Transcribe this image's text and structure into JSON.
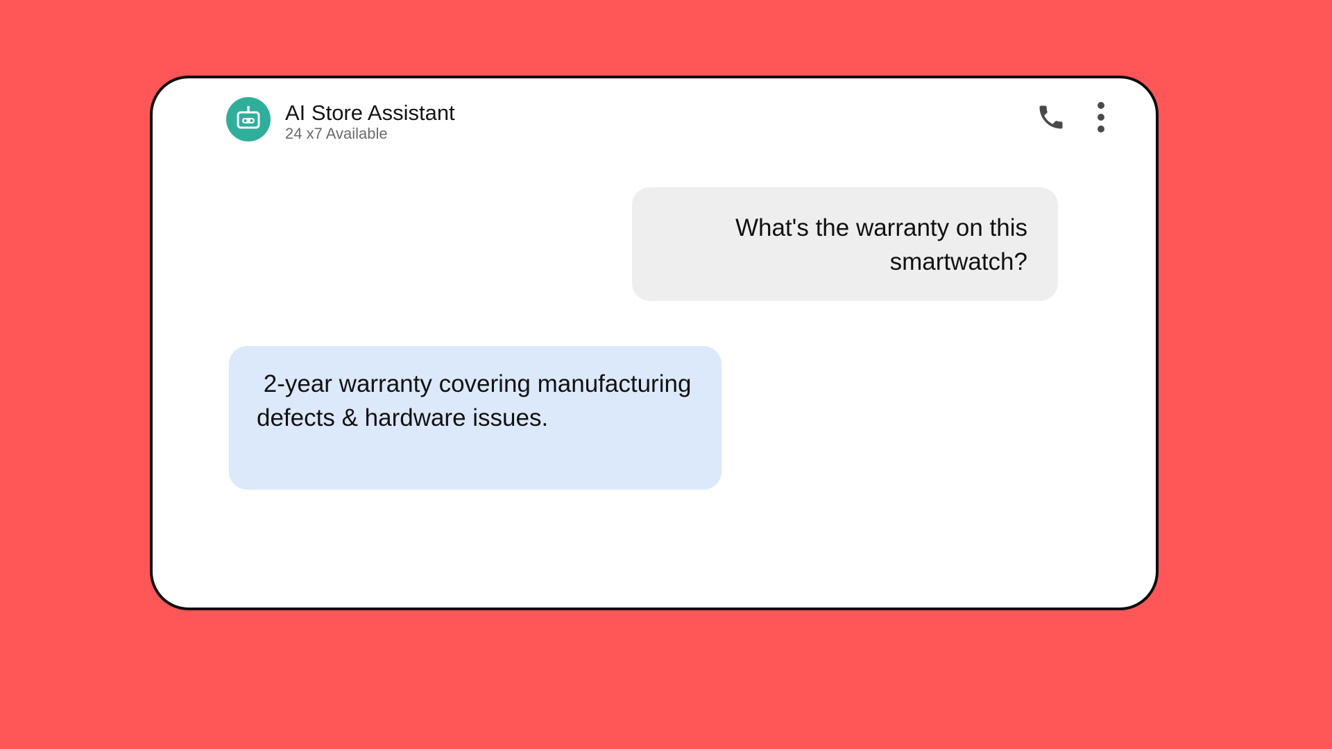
{
  "colors": {
    "background": "#ff5757",
    "card": "#ffffff",
    "avatar": "#2fae9b",
    "user_bubble": "#eeeeee",
    "bot_bubble": "#dbe9fb",
    "icon": "#4a4a4a"
  },
  "header": {
    "avatar_icon": "robot-icon",
    "title": "AI Store Assistant",
    "subtitle": "24 x7 Available",
    "call_icon": "phone-icon",
    "menu_icon": "more-vertical-icon"
  },
  "messages": [
    {
      "sender": "user",
      "text": "What's the warranty on this smartwatch?"
    },
    {
      "sender": "assistant",
      "text": " 2-year warranty covering manufacturing defects & hardware issues."
    }
  ]
}
